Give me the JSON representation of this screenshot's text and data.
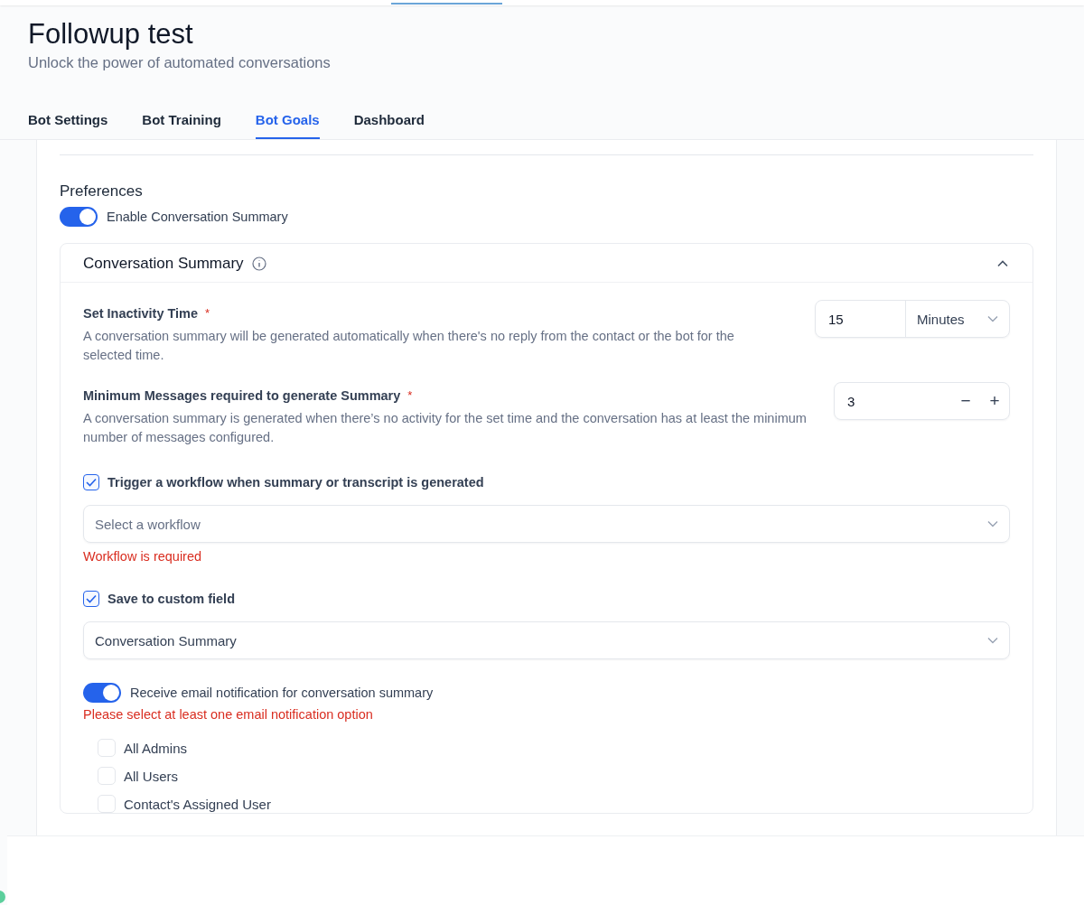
{
  "header": {
    "title": "Followup test",
    "subtitle": "Unlock the power of automated conversations"
  },
  "tabs": [
    {
      "label": "Bot Settings",
      "selected": false
    },
    {
      "label": "Bot Training",
      "selected": false
    },
    {
      "label": "Bot Goals",
      "selected": true
    },
    {
      "label": "Dashboard",
      "selected": false
    }
  ],
  "preferences": {
    "heading": "Preferences",
    "toggle": {
      "label": "Enable Conversation Summary",
      "on": true
    }
  },
  "summary_panel": {
    "title": "Conversation Summary",
    "expanded": true,
    "inactivity": {
      "label": "Set Inactivity Time",
      "required_mark": "*",
      "description": "A conversation summary will be generated automatically when there's no reply from the contact or the bot for the selected time.",
      "value": "15",
      "unit": "Minutes"
    },
    "min_messages": {
      "label": "Minimum Messages required to generate Summary",
      "required_mark": "*",
      "description": "A conversation summary is generated when there’s no activity for the set time and the conversation has at least the minimum number of messages configured.",
      "value": "3",
      "decrement": "−",
      "increment": "+"
    },
    "workflow": {
      "checkbox": {
        "label": "Trigger a workflow when summary or transcript is generated",
        "checked": true
      },
      "select": {
        "placeholder": "Select a workflow"
      },
      "error": "Workflow is required"
    },
    "custom_field": {
      "checkbox": {
        "label": "Save to custom field",
        "checked": true
      },
      "select": {
        "value": "Conversation Summary"
      }
    },
    "email": {
      "toggle": {
        "label": "Receive email notification for conversation summary",
        "on": true
      },
      "error": "Please select at least one email notification option",
      "options": [
        {
          "label": "All Admins",
          "checked": false
        },
        {
          "label": "All Users",
          "checked": false
        },
        {
          "label": "Contact's Assigned User",
          "checked": false
        }
      ]
    }
  }
}
